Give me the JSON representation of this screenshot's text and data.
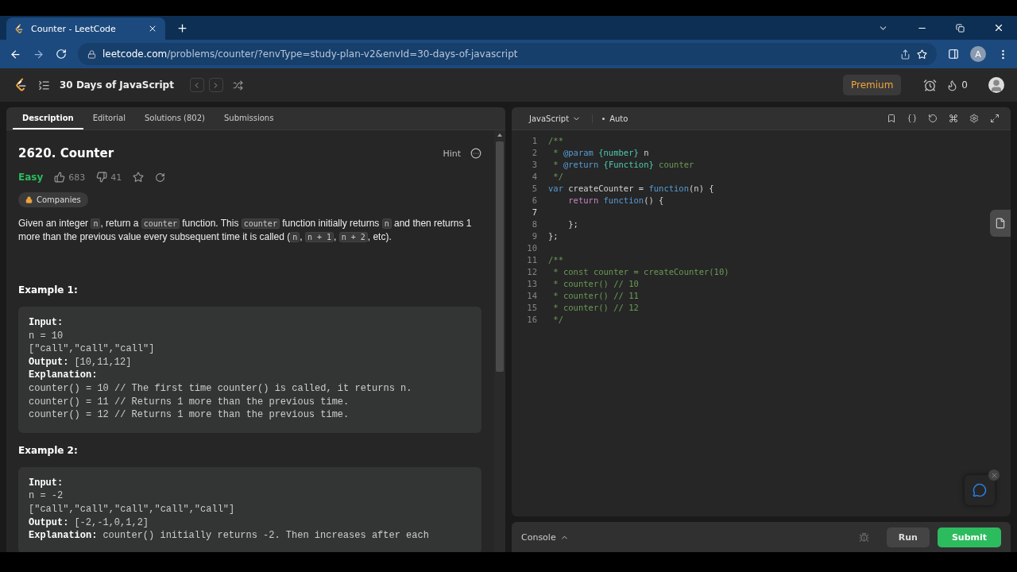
{
  "browser": {
    "tab_title": "Counter - LeetCode",
    "url_host": "leetcode.com",
    "url_path": "/problems/counter/?envType=study-plan-v2&envId=30-days-of-javascript",
    "profile_initial": "A"
  },
  "navbar": {
    "study_plan": "30 Days of JavaScript",
    "premium": "Premium",
    "streak": "0"
  },
  "description_tabs": [
    {
      "label": "Description",
      "selected": true
    },
    {
      "label": "Editorial",
      "selected": false
    },
    {
      "label": "Solutions (802)",
      "selected": false
    },
    {
      "label": "Submissions",
      "selected": false
    }
  ],
  "problem": {
    "title": "2620. Counter",
    "hint": "Hint",
    "difficulty": "Easy",
    "likes": "683",
    "dislikes": "41",
    "companies": "Companies",
    "statement": [
      {
        "text": "Given an integer ",
        "kind": "text"
      },
      {
        "text": "n",
        "kind": "code"
      },
      {
        "text": ", return a ",
        "kind": "text"
      },
      {
        "text": "counter",
        "kind": "code"
      },
      {
        "text": " function. This ",
        "kind": "text"
      },
      {
        "text": "counter",
        "kind": "code"
      },
      {
        "text": " function initially returns ",
        "kind": "text"
      },
      {
        "text": "n",
        "kind": "code"
      },
      {
        "text": " and then returns 1 more than the previous value every subsequent time it is called (",
        "kind": "text"
      },
      {
        "text": "n",
        "kind": "code"
      },
      {
        "text": ", ",
        "kind": "text"
      },
      {
        "text": "n + 1",
        "kind": "code"
      },
      {
        "text": ", ",
        "kind": "text"
      },
      {
        "text": "n + 2",
        "kind": "code"
      },
      {
        "text": ", etc).",
        "kind": "text"
      }
    ],
    "examples": [
      {
        "heading": "Example 1:",
        "lines": [
          {
            "label": "Input:"
          },
          {
            "value": "n = 10"
          },
          {
            "value": "[\"call\",\"call\",\"call\"]"
          },
          {
            "label": "Output:",
            "value": "[10,11,12]"
          },
          {
            "label": "Explanation:"
          },
          {
            "value": "counter() = 10 // The first time counter() is called, it returns n."
          },
          {
            "value": "counter() = 11 // Returns 1 more than the previous time."
          },
          {
            "value": "counter() = 12 // Returns 1 more than the previous time."
          }
        ]
      },
      {
        "heading": "Example 2:",
        "lines": [
          {
            "label": "Input:"
          },
          {
            "value": "n = -2"
          },
          {
            "value": "[\"call\",\"call\",\"call\",\"call\",\"call\"]"
          },
          {
            "label": "Output:",
            "value": "[-2,-1,0,1,2]"
          },
          {
            "label": "Explanation:",
            "value": "counter() initially returns -2. Then increases after each"
          }
        ]
      }
    ]
  },
  "editor": {
    "language": "JavaScript",
    "mode": "Auto",
    "lines": [
      {
        "number": "1",
        "current": false,
        "tokens": [
          {
            "text": "/**",
            "kind": "comment"
          }
        ]
      },
      {
        "number": "2",
        "current": false,
        "tokens": [
          {
            "text": " * ",
            "kind": "comment"
          },
          {
            "text": "@param",
            "kind": "doc-tag"
          },
          {
            "text": " {number}",
            "kind": "doc-type"
          },
          {
            "text": " n",
            "kind": "plain"
          }
        ]
      },
      {
        "number": "3",
        "current": false,
        "tokens": [
          {
            "text": " * ",
            "kind": "comment"
          },
          {
            "text": "@return",
            "kind": "doc-tag"
          },
          {
            "text": " {Function}",
            "kind": "doc-type"
          },
          {
            "text": " counter",
            "kind": "comment"
          }
        ]
      },
      {
        "number": "4",
        "current": false,
        "tokens": [
          {
            "text": " */",
            "kind": "comment"
          }
        ]
      },
      {
        "number": "5",
        "current": false,
        "tokens": [
          {
            "text": "var",
            "kind": "keyword"
          },
          {
            "text": " createCounter = ",
            "kind": "plain"
          },
          {
            "text": "function",
            "kind": "keyword"
          },
          {
            "text": "(n) {",
            "kind": "plain"
          }
        ]
      },
      {
        "number": "6",
        "current": false,
        "tokens": [
          {
            "text": "    return",
            "kind": "control"
          },
          {
            "text": " function",
            "kind": "keyword"
          },
          {
            "text": "() {",
            "kind": "plain"
          }
        ]
      },
      {
        "number": "7",
        "current": true
      },
      {
        "number": "8",
        "current": false,
        "tokens": [
          {
            "text": "    };",
            "kind": "plain"
          }
        ]
      },
      {
        "number": "9",
        "current": false,
        "tokens": [
          {
            "text": "};",
            "kind": "plain"
          }
        ]
      },
      {
        "number": "10",
        "current": false
      },
      {
        "number": "11",
        "current": false,
        "tokens": [
          {
            "text": "/**",
            "kind": "comment"
          }
        ]
      },
      {
        "number": "12",
        "current": false,
        "tokens": [
          {
            "text": " * const counter = createCounter(10)",
            "kind": "comment"
          }
        ]
      },
      {
        "number": "13",
        "current": false,
        "tokens": [
          {
            "text": " * counter() // 10",
            "kind": "comment"
          }
        ]
      },
      {
        "number": "14",
        "current": false,
        "tokens": [
          {
            "text": " * counter() // 11",
            "kind": "comment"
          }
        ]
      },
      {
        "number": "15",
        "current": false,
        "tokens": [
          {
            "text": " * counter() // 12",
            "kind": "comment"
          }
        ]
      },
      {
        "number": "16",
        "current": false,
        "tokens": [
          {
            "text": " */",
            "kind": "comment"
          }
        ]
      }
    ]
  },
  "console": {
    "label": "Console",
    "run": "Run",
    "submit": "Submit"
  }
}
